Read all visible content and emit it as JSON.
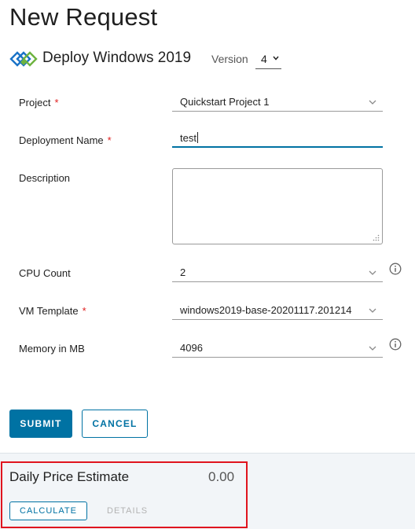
{
  "page_title": "New Request",
  "blueprint": {
    "name": "Deploy Windows 2019",
    "version_label": "Version",
    "version_value": "4"
  },
  "form": {
    "project": {
      "label": "Project",
      "required_mark": "*",
      "value": "Quickstart Project 1"
    },
    "deployment_name": {
      "label": "Deployment Name",
      "required_mark": "*",
      "value": "test"
    },
    "description": {
      "label": "Description",
      "value": ""
    },
    "cpu_count": {
      "label": "CPU Count",
      "value": "2"
    },
    "vm_template": {
      "label": "VM Template",
      "required_mark": "*",
      "value": "windows2019-base-20201117.201214"
    },
    "memory": {
      "label": "Memory in MB",
      "value": "4096"
    }
  },
  "actions": {
    "submit_label": "SUBMIT",
    "cancel_label": "CANCEL"
  },
  "estimate": {
    "title": "Daily Price Estimate",
    "value": "0.00",
    "calculate_label": "CALCULATE",
    "details_label": "DETAILS"
  },
  "colors": {
    "primary": "#0072a3",
    "required": "#e02020",
    "highlight": "#e0141e",
    "logo_blue": "#1a73c7",
    "logo_green": "#6db33f"
  },
  "icons": [
    "blueprint-logo-icon",
    "chevron-down-icon",
    "info-icon",
    "resize-grip-icon"
  ]
}
